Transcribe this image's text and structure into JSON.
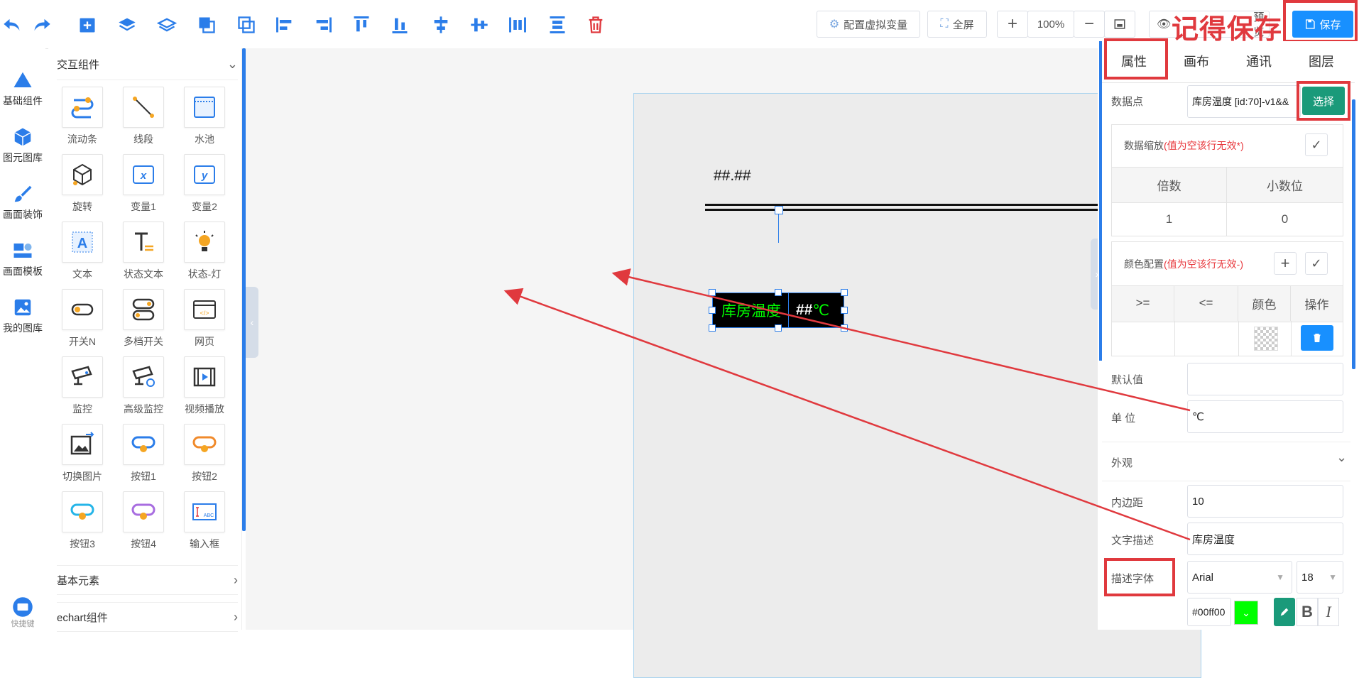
{
  "toolbar": {
    "icons": [
      "undo-icon",
      "redo-icon",
      "bring-front-icon",
      "layer-up-icon",
      "layer-down-icon",
      "group-icon",
      "ungroup-icon",
      "align-left-icon",
      "align-right-icon",
      "align-top-icon",
      "align-bottom-icon",
      "align-center-h-icon",
      "align-center-v-icon",
      "distribute-h-icon",
      "distribute-v-icon",
      "delete-icon"
    ],
    "virtual_var_label": "配置虚拟变量",
    "fullscreen_label": "全屏",
    "zoom_value": "100%",
    "preview_label": "预览",
    "save_label": "保存",
    "annotation": "记得保存"
  },
  "leftnav": [
    {
      "label": "基础组件",
      "icon": "triangle-icon"
    },
    {
      "label": "图元图库",
      "icon": "cube-icon"
    },
    {
      "label": "画面装饰",
      "icon": "brush-icon"
    },
    {
      "label": "画面模板",
      "icon": "template-icon"
    },
    {
      "label": "我的图库",
      "icon": "image-icon"
    }
  ],
  "leftnav_bottom_label": "快捷键",
  "comp_panel": {
    "section1": "交互组件",
    "items": [
      {
        "label": "流动条",
        "icon": "flow-bar-icon"
      },
      {
        "label": "线段",
        "icon": "line-segment-icon"
      },
      {
        "label": "水池",
        "icon": "pool-icon"
      },
      {
        "label": "旋转",
        "icon": "rotate-icon"
      },
      {
        "label": "变量1",
        "icon": "variable-x-icon"
      },
      {
        "label": "变量2",
        "icon": "variable-y-icon"
      },
      {
        "label": "文本",
        "icon": "text-icon"
      },
      {
        "label": "状态文本",
        "icon": "status-text-icon"
      },
      {
        "label": "状态-灯",
        "icon": "lamp-icon"
      },
      {
        "label": "开关N",
        "icon": "switch-icon"
      },
      {
        "label": "多档开关",
        "icon": "multi-switch-icon"
      },
      {
        "label": "网页",
        "icon": "webpage-icon"
      },
      {
        "label": "监控",
        "icon": "camera-icon"
      },
      {
        "label": "高级监控",
        "icon": "advanced-camera-icon"
      },
      {
        "label": "视频播放",
        "icon": "video-icon"
      },
      {
        "label": "切换图片",
        "icon": "switch-image-icon"
      },
      {
        "label": "按钮1",
        "icon": "button1-icon"
      },
      {
        "label": "按钮2",
        "icon": "button2-icon"
      },
      {
        "label": "按钮3",
        "icon": "button3-icon"
      },
      {
        "label": "按钮4",
        "icon": "button4-icon"
      },
      {
        "label": "输入框",
        "icon": "input-box-icon"
      }
    ],
    "section2": "基本元素",
    "section3": "echart组件"
  },
  "canvas": {
    "placeholder_value": "##.##",
    "widget_desc": "库房温度",
    "widget_value": "##",
    "widget_unit": "℃"
  },
  "right_panel": {
    "tabs": [
      "属性",
      "画布",
      "通讯",
      "图层"
    ],
    "datapoint_label": "数据点",
    "datapoint_value": "库房温度 [id:70]-v1&&",
    "select_label": "选择",
    "scaling_title": "数据缩放",
    "scaling_note": "(值为空该行无效*)",
    "scaling_headers": [
      "倍数",
      "小数位"
    ],
    "scaling_values": [
      "1",
      "0"
    ],
    "color_title": "颜色配置",
    "color_note": "(值为空该行无效-)",
    "color_headers": [
      ">=",
      "<=",
      "颜色",
      "操作"
    ],
    "default_label": "默认值",
    "default_value": "",
    "unit_label": "单 位",
    "unit_value": "℃",
    "appearance_label": "外观",
    "padding_label": "内边距",
    "padding_value": "10",
    "textdesc_label": "文字描述",
    "textdesc_value": "库房温度",
    "font_label": "描述字体",
    "font_value": "Arial",
    "font_size": "18",
    "color_value": "#00ff00",
    "accent_color": "#1890ff",
    "select_color": "#1a9a7a",
    "font_green": "#00ff00"
  }
}
